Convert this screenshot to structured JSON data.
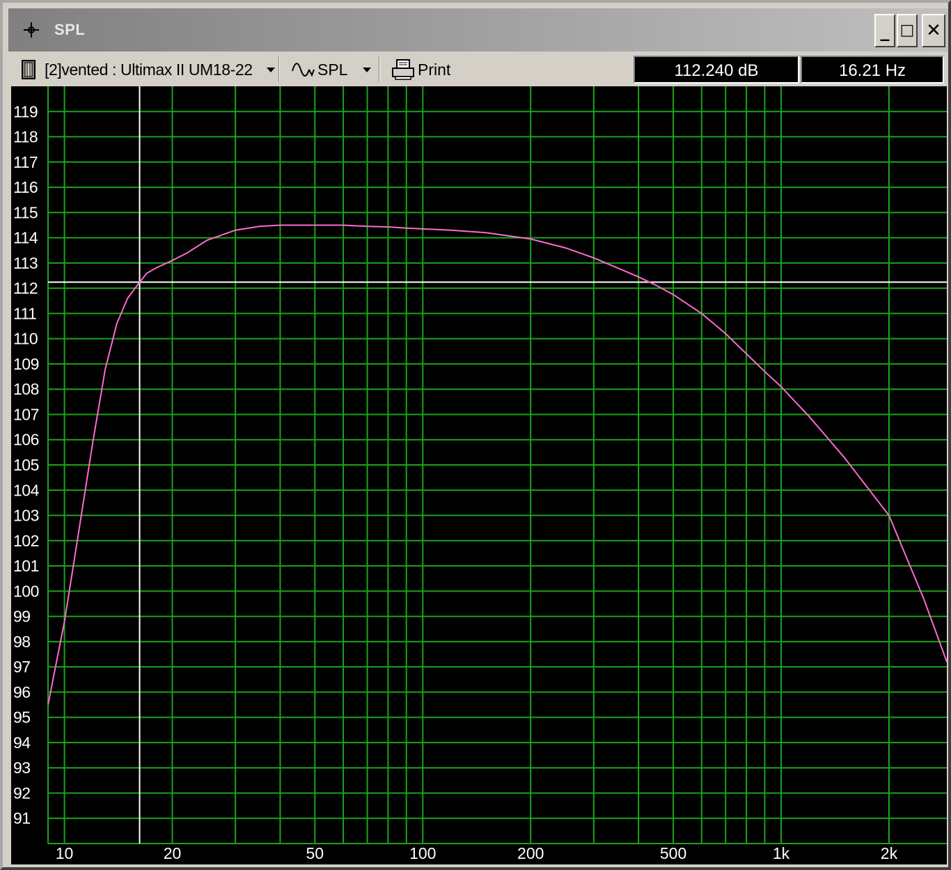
{
  "window": {
    "title": "SPL",
    "minimize_glyph": "_",
    "maximize_glyph": "□",
    "close_glyph": "✕"
  },
  "toolbar": {
    "project_label": "[2]vented : Ultimax II UM18-22",
    "graph_label": "SPL",
    "print_label": "Print"
  },
  "readout": {
    "level": "112.240 dB",
    "frequency": "16.21 Hz"
  },
  "icons": {
    "title": "crosshair-icon",
    "project": "speaker-box-icon",
    "graph": "sine-wave-icon",
    "print": "printer-icon"
  },
  "colors": {
    "background": "#000000",
    "grid": "#1aa51a",
    "curve": "#ff6ad0",
    "cursor": "#ffffff",
    "label": "#ffffff"
  },
  "chart_data": {
    "type": "line",
    "x_scale": "log",
    "xlim": [
      9,
      2900
    ],
    "ylim": [
      90,
      120
    ],
    "x_tick_labels": [
      {
        "value": 10,
        "label": "10"
      },
      {
        "value": 20,
        "label": "20"
      },
      {
        "value": 50,
        "label": "50"
      },
      {
        "value": 100,
        "label": "100"
      },
      {
        "value": 200,
        "label": "200"
      },
      {
        "value": 500,
        "label": "500"
      },
      {
        "value": 1000,
        "label": "1k"
      },
      {
        "value": 2000,
        "label": "2k"
      }
    ],
    "y_tick_labels": [
      "91",
      "92",
      "93",
      "94",
      "95",
      "96",
      "97",
      "98",
      "99",
      "100",
      "101",
      "102",
      "103",
      "104",
      "105",
      "106",
      "107",
      "108",
      "109",
      "110",
      "111",
      "112",
      "113",
      "114",
      "115",
      "116",
      "117",
      "118",
      "119"
    ],
    "cursor": {
      "x": 16.21,
      "y": 112.24
    },
    "series": [
      {
        "x": [
          9,
          10,
          11,
          12,
          13,
          14,
          15,
          16.21,
          17,
          18,
          20,
          22,
          25,
          30,
          35,
          40,
          45,
          50,
          55,
          60,
          70,
          80,
          90,
          100,
          120,
          150,
          200,
          250,
          300,
          350,
          400,
          450,
          500,
          600,
          700,
          800,
          900,
          1000,
          1200,
          1500,
          2000,
          2500,
          2900
        ],
        "y": [
          95.5,
          98.8,
          102.5,
          105.9,
          108.8,
          110.6,
          111.6,
          112.24,
          112.6,
          112.8,
          113.1,
          113.4,
          113.9,
          114.3,
          114.45,
          114.5,
          114.5,
          114.5,
          114.5,
          114.5,
          114.45,
          114.43,
          114.38,
          114.35,
          114.3,
          114.2,
          113.95,
          113.6,
          113.2,
          112.8,
          112.45,
          112.1,
          111.75,
          111.0,
          110.2,
          109.4,
          108.7,
          108.1,
          106.9,
          105.3,
          103.0,
          99.7,
          97.2
        ]
      }
    ]
  }
}
